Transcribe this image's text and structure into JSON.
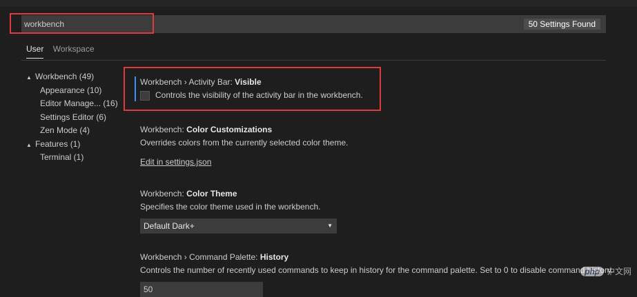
{
  "search": {
    "value": "workbench",
    "results_count": "50 Settings Found"
  },
  "tabs": [
    {
      "label": "User",
      "active": true
    },
    {
      "label": "Workspace",
      "active": false
    }
  ],
  "toc": [
    {
      "label": "Workbench (49)",
      "level": 1,
      "caret": "▲"
    },
    {
      "label": "Appearance (10)",
      "level": 2
    },
    {
      "label": "Editor Manage... (16)",
      "level": 2
    },
    {
      "label": "Settings Editor (6)",
      "level": 2
    },
    {
      "label": "Zen Mode (4)",
      "level": 2
    },
    {
      "label": "Features (1)",
      "level": 1,
      "caret": "▲"
    },
    {
      "label": "Terminal (1)",
      "level": 2
    }
  ],
  "settings": {
    "activity_bar": {
      "category": "Workbench › Activity Bar: ",
      "name": "Visible",
      "description": "Controls the visibility of the activity bar in the workbench."
    },
    "color_customizations": {
      "category": "Workbench: ",
      "name": "Color Customizations",
      "description": "Overrides colors from the currently selected color theme.",
      "link": "Edit in settings.json"
    },
    "color_theme": {
      "category": "Workbench: ",
      "name": "Color Theme",
      "description": "Specifies the color theme used in the workbench.",
      "value": "Default Dark+"
    },
    "command_palette_history": {
      "category": "Workbench › Command Palette: ",
      "name": "History",
      "description": "Controls the number of recently used commands to keep in history for the command palette. Set to 0 to disable command history.",
      "value": "50"
    }
  },
  "watermark": {
    "logo": "php",
    "text": "中文网"
  },
  "colors": {
    "background": "#1e1e1e",
    "input": "#3c3c3c",
    "highlight_border": "#e03a3e",
    "focus": "#3794ff"
  }
}
